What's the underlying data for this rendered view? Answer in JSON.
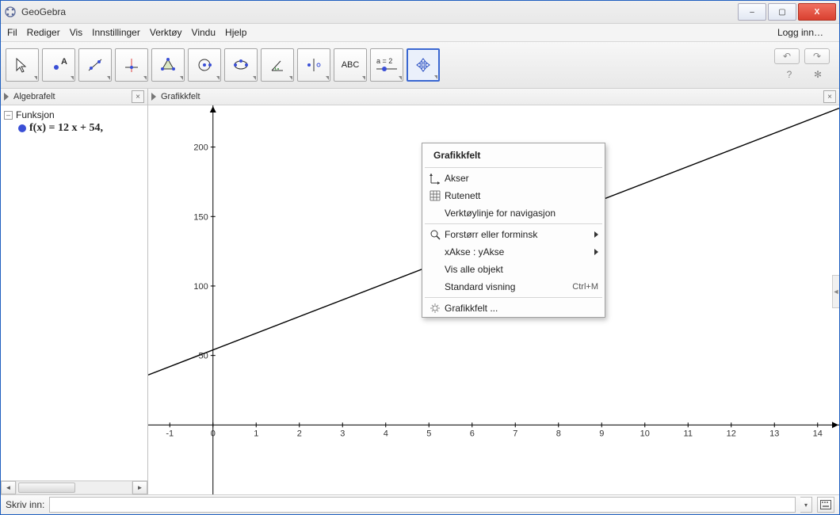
{
  "window": {
    "title": "GeoGebra"
  },
  "window_controls": {
    "min": "–",
    "max": "▢",
    "close": "X"
  },
  "menubar": {
    "file": "Fil",
    "edit": "Rediger",
    "view": "Vis",
    "settings": "Innstillinger",
    "tools": "Verktøy",
    "window": "Vindu",
    "help": "Hjelp",
    "login": "Logg inn…"
  },
  "toolbar": {
    "t1": "",
    "t2": "A",
    "t3": "",
    "t4": "",
    "t5": "",
    "t6": "",
    "t7": "",
    "t8": "",
    "t9": "",
    "t10": "ABC",
    "t11": "a = 2",
    "t12": "",
    "undo": "↶",
    "redo": "↷",
    "help": "?",
    "prefs": "✻"
  },
  "panels": {
    "algebra": "Algebrafelt",
    "graphics": "Grafikkfelt"
  },
  "algebra": {
    "category": "Funksjon",
    "func": "f(x)  =  12 x + 54,"
  },
  "chart_data": {
    "type": "line",
    "title": "",
    "xlabel": "",
    "ylabel": "",
    "xlim": [
      -1.5,
      14.5
    ],
    "ylim": [
      -50,
      230
    ],
    "x_ticks": [
      -1,
      0,
      1,
      2,
      3,
      4,
      5,
      6,
      7,
      8,
      9,
      10,
      11,
      12,
      13,
      14
    ],
    "y_ticks": [
      50,
      100,
      150,
      200
    ],
    "series": [
      {
        "name": "f",
        "formula": "12*x + 54",
        "x": [
          -1.5,
          14.5
        ],
        "y": [
          36,
          228
        ]
      }
    ]
  },
  "context_menu": {
    "title": "Grafikkfelt",
    "axes": "Akser",
    "grid": "Rutenett",
    "navbar": "Verktøylinje for navigasjon",
    "zoom": "Forstørr eller forminsk",
    "ratio": "xAkse : yAkse",
    "showall": "Vis alle objekt",
    "standard": "Standard visning",
    "standard_shortcut": "Ctrl+M",
    "props": "Grafikkfelt ..."
  },
  "inputbar": {
    "label": "Skriv inn:"
  }
}
